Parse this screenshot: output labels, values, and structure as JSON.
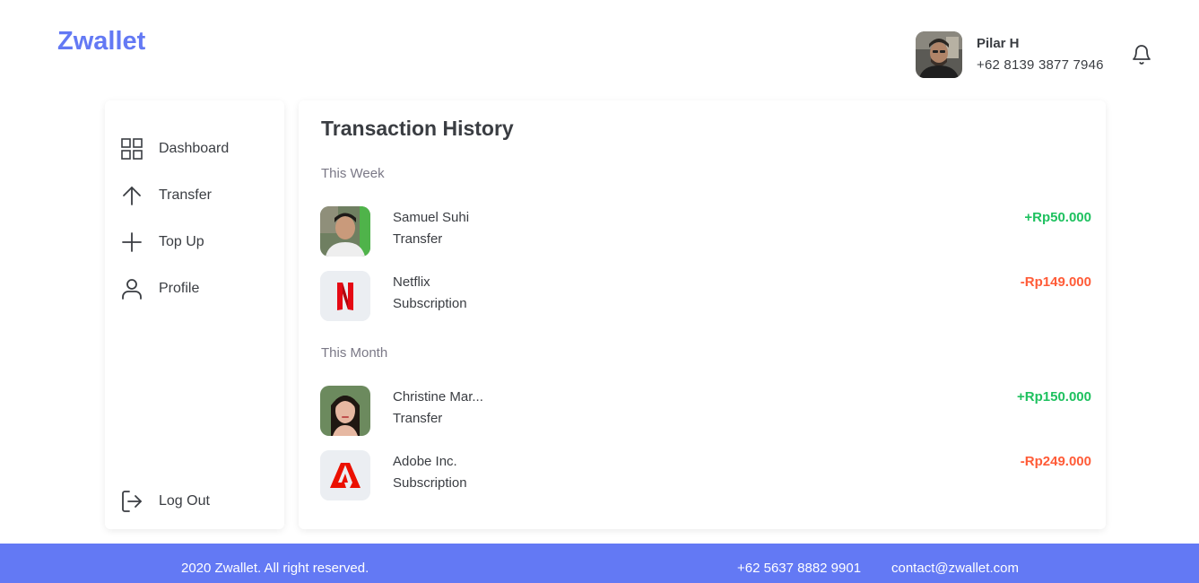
{
  "brand": {
    "name": "Zwallet",
    "color": "#6379f4"
  },
  "user": {
    "name": "Pilar H",
    "phone": "+62 8139 3877 7946",
    "avatar": "user-avatar-photo",
    "notification_icon": "bell-icon"
  },
  "sidebar": {
    "items": [
      {
        "label": "Dashboard",
        "icon": "grid-icon"
      },
      {
        "label": "Transfer",
        "icon": "arrow-up-icon"
      },
      {
        "label": "Top Up",
        "icon": "plus-icon"
      },
      {
        "label": "Profile",
        "icon": "user-icon"
      }
    ],
    "logout": {
      "label": "Log Out",
      "icon": "logout-icon"
    }
  },
  "main": {
    "title": "Transaction History",
    "sections": [
      {
        "label": "This Week",
        "transactions": [
          {
            "name": "Samuel Suhi",
            "type": "Transfer",
            "amount": "+Rp50.000",
            "direction": "in",
            "thumb": "person-photo"
          },
          {
            "name": "Netflix",
            "type": "Subscription",
            "amount": "-Rp149.000",
            "direction": "out",
            "thumb": "netflix-logo"
          }
        ]
      },
      {
        "label": "This Month",
        "transactions": [
          {
            "name": "Christine Mar...",
            "type": "Transfer",
            "amount": "+Rp150.000",
            "direction": "in",
            "thumb": "person-photo"
          },
          {
            "name": "Adobe Inc.",
            "type": "Subscription",
            "amount": "-Rp249.000",
            "direction": "out",
            "thumb": "adobe-logo"
          }
        ]
      }
    ]
  },
  "footer": {
    "copyright": "2020 Zwallet. All right reserved.",
    "phone": "+62 5637 8882 9901",
    "email": "contact@zwallet.com"
  },
  "colors": {
    "positive": "#1ec15f",
    "negative": "#ff5b37",
    "text": "#3a3d42",
    "muted": "#7a7886"
  }
}
